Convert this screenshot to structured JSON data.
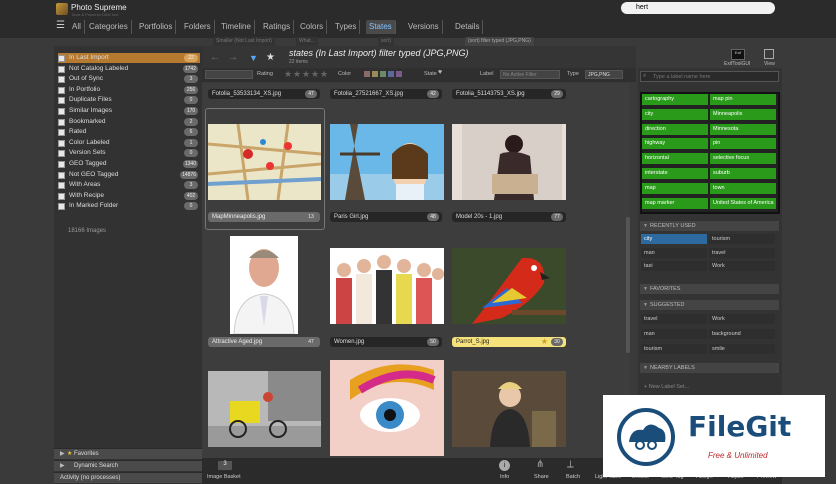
{
  "app": {
    "title": "Photo Supreme",
    "subtitle": "Tools & Powerful DAM tool"
  },
  "nav": {
    "tabs": [
      "All",
      "Categories",
      "Portfolios",
      "Folders",
      "Timeline",
      "Ratings",
      "Colors",
      "Types",
      "States",
      "Versions",
      "Details"
    ],
    "active": "States"
  },
  "search": {
    "value": "hert"
  },
  "doc_tabs": [
    "Smaller (Not Last Import)",
    "What...",
    "sort)",
    "(sort) filter typed (JPG,PNG)"
  ],
  "left": {
    "filters": [
      {
        "label": "In Last Import",
        "count": "22",
        "selected": true
      },
      {
        "label": "Not Catalog Labeled",
        "count": "1742"
      },
      {
        "label": "Out of Sync",
        "count": "3"
      },
      {
        "label": "In Portfolio",
        "count": "256"
      },
      {
        "label": "Duplicate Files",
        "count": "0"
      },
      {
        "label": "Similar Images",
        "count": "170"
      },
      {
        "label": "Bookmarked",
        "count": "2"
      },
      {
        "label": "Rated",
        "count": "6"
      },
      {
        "label": "Color Labeled",
        "count": "1"
      },
      {
        "label": "Version Sets",
        "count": "0"
      },
      {
        "label": "GEO Tagged",
        "count": "1340"
      },
      {
        "label": "Not GEO Tagged",
        "count": "14876"
      },
      {
        "label": "With Areas",
        "count": "3"
      },
      {
        "label": "With Recipe",
        "count": "402"
      },
      {
        "label": "In Marked Folder",
        "count": "0"
      }
    ],
    "total": "18166 Images",
    "sections": [
      "Favorites",
      "Dynamic Search",
      "Activity (no processes)"
    ]
  },
  "main": {
    "title": "states (In Last Import) filter typed (JPG,PNG)",
    "count": "22 items",
    "filterbar": {
      "rating": "Rating",
      "color": "Color",
      "state": "State",
      "label": "Label",
      "label_value": "No Active Filter",
      "type": "Type",
      "type_value": "JPG,PNG"
    },
    "top_captions": [
      {
        "name": "Fotolia_53533134_XS.jpg",
        "n": "47"
      },
      {
        "name": "Fotolia_27521667_XS.jpg",
        "n": "42"
      },
      {
        "name": "Fotolia_51143753_XS.jpg",
        "n": "29"
      }
    ],
    "items": [
      {
        "name": "MapMinneapolis.jpg",
        "n": "13"
      },
      {
        "name": "Paris Girl.jpg",
        "n": "48"
      },
      {
        "name": "Model 20s - 1.jpg",
        "n": "77"
      },
      {
        "name": "Attractive Aged.jpg",
        "n": "47"
      },
      {
        "name": "Women.jpg",
        "n": "50"
      },
      {
        "name": "Parrot_S.jpg",
        "n": "30"
      }
    ]
  },
  "right": {
    "toolbar": {
      "exif": "ExifToolGUI",
      "view": "View"
    },
    "search_placeholder": "Type a label name here",
    "catalog_labels": [
      [
        "cartography",
        "map pin"
      ],
      [
        "city",
        "Minneapolis"
      ],
      [
        "direction",
        "Minnesota"
      ],
      [
        "highway",
        "pin"
      ],
      [
        "horizontal",
        "selective focus"
      ],
      [
        "interstate",
        "suburb"
      ],
      [
        "map",
        "town"
      ],
      [
        "map marker",
        "United States of America"
      ]
    ],
    "recently_used_title": "RECENTLY USED",
    "recently_used": [
      [
        "city",
        "tourism"
      ],
      [
        "man",
        "travel"
      ],
      [
        "taxi",
        "Work"
      ]
    ],
    "favorites_title": "FAVORITES",
    "suggested_title": "SUGGESTED",
    "suggested": [
      [
        "travel",
        "Work"
      ],
      [
        "man",
        "background"
      ],
      [
        "tourism",
        "smile"
      ]
    ],
    "nearby_title": "NEARBY LABELS",
    "new_label": "+ New Label Set..."
  },
  "bottom": {
    "basket": "Image Basket",
    "basket_count": "3",
    "tools": [
      "Info",
      "Share",
      "Batch",
      "Light Table",
      "Details",
      "GEO Tag",
      "Assign",
      "Adjust",
      "Preview"
    ]
  },
  "watermark": {
    "title": "FileGit",
    "sub": "Free & Unlimited"
  },
  "colors": {
    "accent": "#56a9ff",
    "selected": "#b57a2f",
    "green": "#2a9a1a"
  }
}
